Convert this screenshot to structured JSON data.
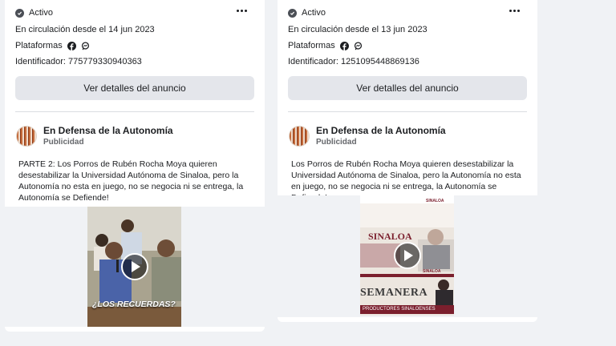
{
  "cards": [
    {
      "status": "Activo",
      "circulation": "En circulación desde el 14 jun 2023",
      "platforms_label": "Plataformas",
      "identifier": "Identificador: 775779330940363",
      "details_button": "Ver detalles del anuncio",
      "page_name": "En Defensa de la Autonomía",
      "sponsored": "Publicidad",
      "ad_text": "PARTE 2: Los Porros de Rubén Rocha Moya quieren desestabilizar la Universidad Autónoma de Sinaloa, pero la Autonomía no esta en juego, no se negocia ni se entrega, la Autonomía se Defiende!",
      "video_caption": "¿LOS RECUERDAS?"
    },
    {
      "status": "Activo",
      "circulation": "En circulación desde el 13 jun 2023",
      "platforms_label": "Plataformas",
      "identifier": "Identificador: 1251095448869136",
      "details_button": "Ver detalles del anuncio",
      "page_name": "En Defensa de la Autonomía",
      "sponsored": "Publicidad",
      "ad_text": "Los Porros de Rubén Rocha Moya quieren desestabilizar la Universidad Autónoma de Sinaloa, pero la Autonomía no esta en juego, no se negocia ni se entrega, la Autonomía se Defiende!",
      "video_title": "SINALOA",
      "video_banner": "SEMANERA",
      "video_strip": "PRODUCTORES SINALOENSES",
      "video_logo": "SINALOA",
      "video_logo2": "SINALOA"
    }
  ],
  "icons": {
    "status": "check-circle-icon",
    "more": "more-horizontal-icon",
    "facebook": "facebook-icon",
    "messenger": "messenger-icon",
    "play": "play-icon"
  },
  "colors": {
    "background": "#f0f2f5",
    "card": "#ffffff",
    "button": "#e4e6eb",
    "muted_text": "#65676b",
    "sinaloa_maroon": "#7b1f2d"
  }
}
